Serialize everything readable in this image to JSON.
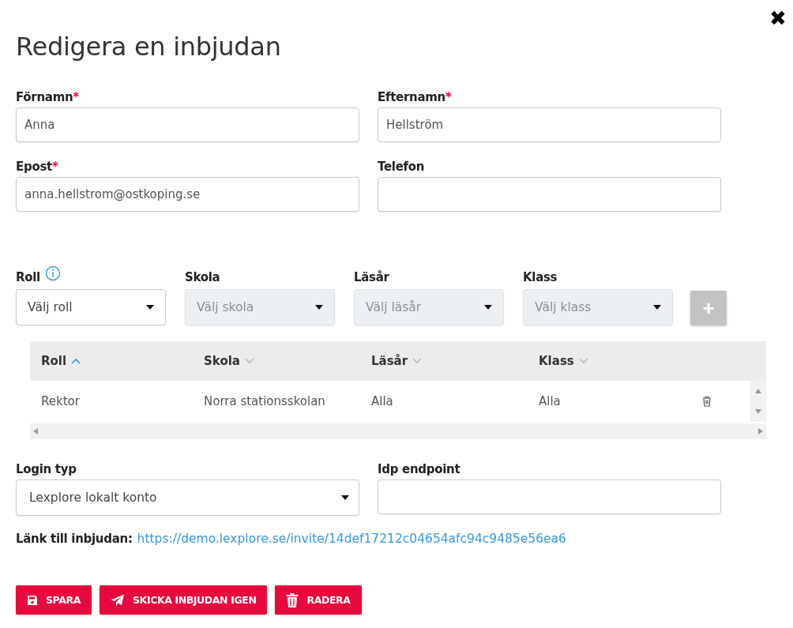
{
  "dialog": {
    "title": "Redigera en inbjudan",
    "close": "✖"
  },
  "fields": [
    {
      "label": "Förnamn",
      "required_mark": "*",
      "value": "Anna"
    },
    {
      "label": "Efternamn",
      "required_mark": "*",
      "value": "Hellström"
    },
    {
      "label": "Epost",
      "required_mark": "*",
      "value": "anna.hellstrom@ostkoping.se"
    },
    {
      "label": "Telefon"
    }
  ],
  "role_selects": [
    {
      "label": "Roll",
      "info": true,
      "placeholder": "Välj roll",
      "disabled": false
    },
    {
      "label": "Skola",
      "info": false,
      "placeholder": "Välj skola",
      "disabled": true
    },
    {
      "label": "Läsår",
      "info": false,
      "placeholder": "Välj läsår",
      "disabled": true
    },
    {
      "label": "Klass",
      "info": false,
      "placeholder": "Välj klass",
      "disabled": true
    }
  ],
  "add_button": {
    "label": "+",
    "disabled": true
  },
  "table": {
    "columns": [
      {
        "label": "Roll",
        "sorted": true
      },
      {
        "label": "Skola",
        "sorted": false
      },
      {
        "label": "Läsår",
        "sorted": false
      },
      {
        "label": "Klass",
        "sorted": false
      }
    ],
    "rows": [
      {
        "cells": [
          "Rektor",
          "Norra stationsskolan",
          "Alla",
          "Alla"
        ]
      }
    ]
  },
  "login": {
    "label": "Login typ",
    "value": "Lexplore lokalt konto"
  },
  "idp": {
    "label": "Idp endpoint"
  },
  "invite_link": {
    "label": "Länk till inbjudan:",
    "url": "https://demo.lexplore.se/invite/14def17212c04654afc94c9485e56ea6"
  },
  "buttons": [
    {
      "kind": "save",
      "label": "SPARA"
    },
    {
      "kind": "send",
      "label": "SKICKA INBJUDAN IGEN"
    },
    {
      "kind": "delete",
      "label": "RADERA"
    }
  ]
}
